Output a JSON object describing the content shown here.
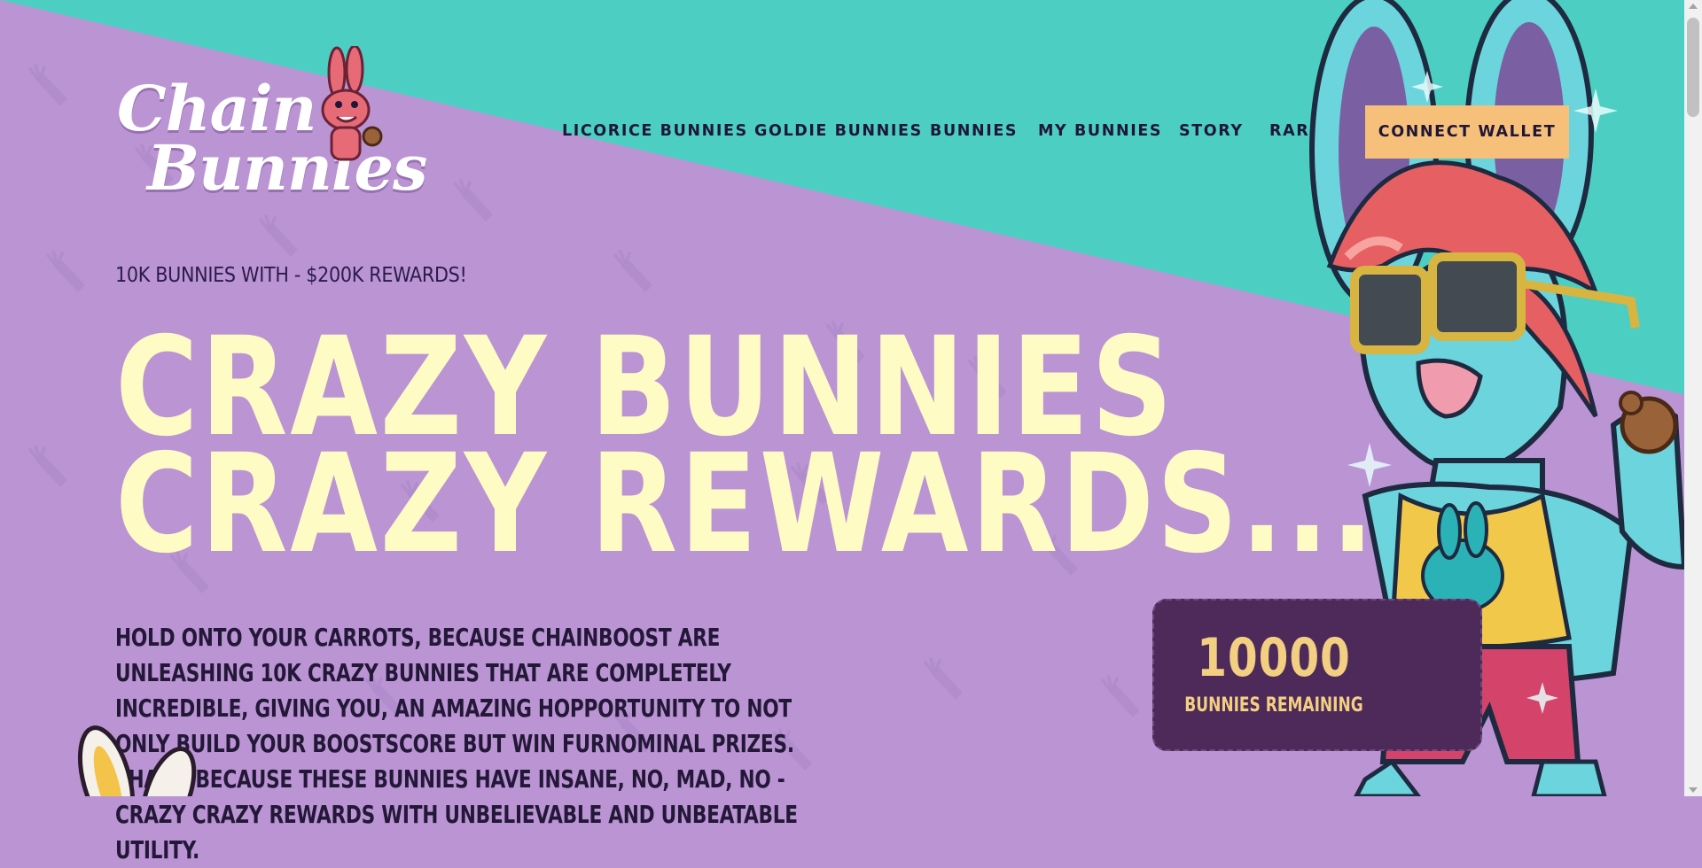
{
  "brand": {
    "logo_line1": "Chain",
    "logo_line2": "Bunnies",
    "colors": {
      "teal": "#4ccfc2",
      "purple": "#bb94d4",
      "cream": "#fefcc4",
      "button": "#f7c07a",
      "card": "#4d2a5a",
      "gold": "#f3cf82",
      "navy": "#1f1638"
    }
  },
  "nav": {
    "items": [
      "LICORICE BUNNIES",
      "GOLDIE BUNNIES",
      "BUNNIES",
      "MY BUNNIES",
      "STORY",
      "RARITY"
    ],
    "connect_label": "CONNECT WALLET"
  },
  "hero": {
    "tagline": "10K BUNNIES WITH - $200K REWARDS!",
    "headline_line1": "CRAZY BUNNIES",
    "headline_line2": "CRAZY REWARDS...",
    "description": "HOLD ONTO YOUR CARROTS, BECAUSE CHAINBOOST ARE UNLEASHING 10K CRAZY BUNNIES THAT ARE COMPLETELY INCREDIBLE, GIVING YOU, AN AMAZING HOPPORTUNITY TO NOT ONLY BUILD YOUR BOOSTSCORE BUT WIN FURNOMINAL PRIZES. THAT'S BECAUSE THESE BUNNIES HAVE INSANE, NO, MAD, NO - CRAZY CRAZY REWARDS WITH UNBELIEVABLE AND UNBEATABLE UTILITY."
  },
  "counter": {
    "count": "10000",
    "label": "BUNNIES REMAINING"
  },
  "icons": [
    "logo-bunny-icon",
    "mascot-bunny-illustration",
    "bottom-bunny-ears-icon",
    "carrot-pattern"
  ]
}
